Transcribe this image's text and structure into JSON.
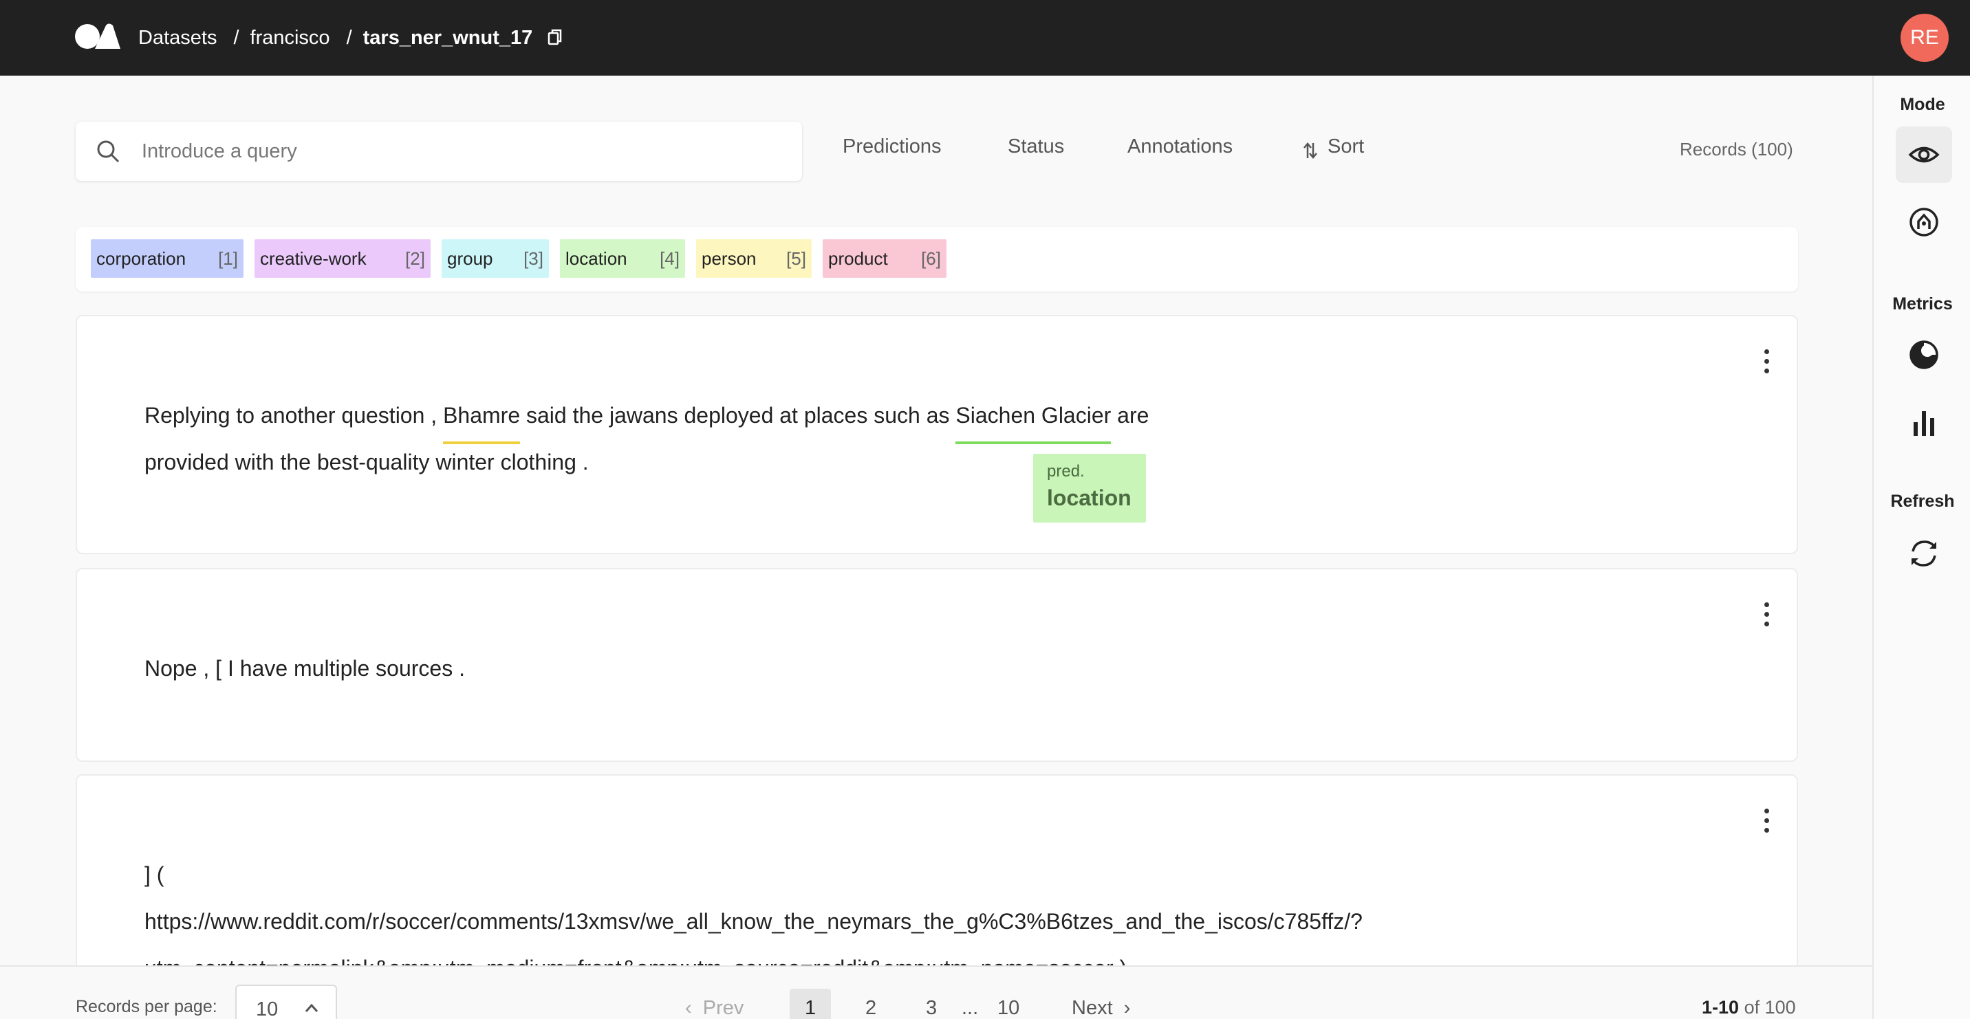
{
  "header": {
    "breadcrumbs": [
      "Datasets",
      "francisco",
      "tars_ner_wnut_17"
    ],
    "avatar_initials": "RE",
    "avatar_color": "#f0695a"
  },
  "sidebar": {
    "mode_title": "Mode",
    "metrics_title": "Metrics",
    "refresh_title": "Refresh",
    "buttons": [
      "explore-eye-icon",
      "annotate-icon",
      "metrics-progress-icon",
      "metrics-bar-chart-icon",
      "refresh-icon"
    ]
  },
  "toolbar": {
    "search_placeholder": "Introduce a query",
    "filters": [
      "Predictions",
      "Status",
      "Annotations",
      "Sort"
    ],
    "records_count": "Records (100)"
  },
  "labels": [
    {
      "name": "corporation",
      "key": "[1]",
      "color": "#c3cefc"
    },
    {
      "name": "creative-work",
      "key": "[2]",
      "color": "#ebcafb"
    },
    {
      "name": "group",
      "key": "[3]",
      "color": "#cdf6f9"
    },
    {
      "name": "location",
      "key": "[4]",
      "color": "#d3f7c6"
    },
    {
      "name": "person",
      "key": "[5]",
      "color": "#fdf7bf"
    },
    {
      "name": "product",
      "key": "[6]",
      "color": "#f9c8d4"
    }
  ],
  "records": [
    {
      "line1": {
        "pre": "Replying to another question ,",
        "ent1": "Bhamre",
        "ent1_color": "#f0cf3c",
        "mid": "said the jawans deployed at places such as",
        "ent2": "Siachen Glacier",
        "ent2_color": "#7ddb5e",
        "post": "are"
      },
      "line2": "provided with the best-quality winter clothing .",
      "tooltip": {
        "kind": "pred.",
        "label": "location"
      }
    },
    {
      "line1": "Nope , [ I have multiple sources ."
    },
    {
      "line1": "] (",
      "line2": "https://www.reddit.com/r/soccer/comments/13xmsv/we_all_know_the_neymars_the_g%C3%B6tzes_and_the_iscos/c785ffz/?",
      "line3": "utm_content=permalink&amp;utm_medium=front&amp;utm_source=reddit&amp;utm_name=soccer )"
    }
  ],
  "pagination": {
    "per_page_label": "Records per page:",
    "per_page_value": "10",
    "prev": "Prev",
    "pages": [
      "1",
      "2",
      "3",
      "10"
    ],
    "ellipsis": "...",
    "next": "Next",
    "range_bold": "1-10",
    "range_rest": "of 100"
  }
}
